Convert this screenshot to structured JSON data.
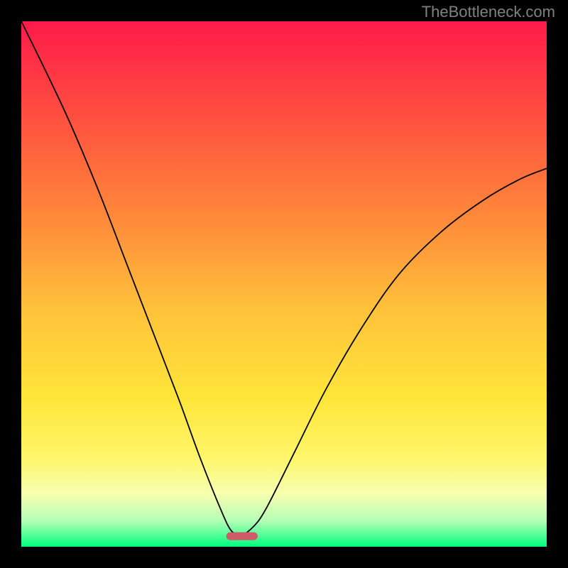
{
  "watermark": "TheBottleneck.com",
  "chart_data": {
    "type": "line",
    "title": "",
    "xlabel": "",
    "ylabel": "",
    "xlim": [
      0,
      100
    ],
    "ylim": [
      0,
      100
    ],
    "x_min_at": 42,
    "marker": {
      "x": 42,
      "y": 2,
      "color": "#cf5a68",
      "width": 6,
      "height": 1.5
    },
    "gradient_stops": [
      {
        "offset": 0,
        "color": "#ff1a4b"
      },
      {
        "offset": 18,
        "color": "#ff4f3f"
      },
      {
        "offset": 38,
        "color": "#ff8b3a"
      },
      {
        "offset": 55,
        "color": "#ffc23a"
      },
      {
        "offset": 72,
        "color": "#ffe63a"
      },
      {
        "offset": 83,
        "color": "#fff66a"
      },
      {
        "offset": 90,
        "color": "#f7ffb0"
      },
      {
        "offset": 95,
        "color": "#b6ffb6"
      },
      {
        "offset": 100,
        "color": "#00ff7f"
      }
    ],
    "curve_points": [
      {
        "x": 0,
        "y": 100
      },
      {
        "x": 5,
        "y": 90
      },
      {
        "x": 10,
        "y": 79
      },
      {
        "x": 15,
        "y": 67
      },
      {
        "x": 20,
        "y": 54
      },
      {
        "x": 25,
        "y": 41
      },
      {
        "x": 30,
        "y": 28
      },
      {
        "x": 34,
        "y": 17
      },
      {
        "x": 38,
        "y": 7
      },
      {
        "x": 40,
        "y": 3
      },
      {
        "x": 42,
        "y": 2
      },
      {
        "x": 44,
        "y": 3
      },
      {
        "x": 47,
        "y": 8
      },
      {
        "x": 52,
        "y": 18
      },
      {
        "x": 58,
        "y": 30
      },
      {
        "x": 65,
        "y": 42
      },
      {
        "x": 72,
        "y": 52
      },
      {
        "x": 80,
        "y": 60
      },
      {
        "x": 88,
        "y": 66
      },
      {
        "x": 95,
        "y": 70
      },
      {
        "x": 100,
        "y": 72
      }
    ]
  }
}
